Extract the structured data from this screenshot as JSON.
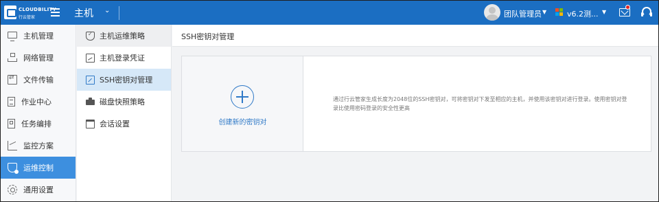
{
  "header": {
    "brand": "CLOUDBILITY",
    "brand_sub": "行云管家",
    "module_title": "主机",
    "user_name": "团队管理员",
    "region_name": "v6.2测..."
  },
  "sidebar": {
    "items": [
      {
        "label": "主机管理",
        "icon": "monitor-icon"
      },
      {
        "label": "网络管理",
        "icon": "network-icon"
      },
      {
        "label": "文件传输",
        "icon": "file-transfer-icon"
      },
      {
        "label": "作业中心",
        "icon": "task-icon"
      },
      {
        "label": "任务编排",
        "icon": "schedule-icon"
      },
      {
        "label": "监控方案",
        "icon": "chart-icon"
      },
      {
        "label": "运维控制",
        "icon": "shield-icon",
        "active": true
      },
      {
        "label": "通用设置",
        "icon": "gear-icon"
      }
    ]
  },
  "submenu": {
    "items": [
      {
        "label": "主机运维策略",
        "icon": "shield-check-icon"
      },
      {
        "label": "主机登录凭证",
        "icon": "login-credential-icon"
      },
      {
        "label": "SSH密钥对管理",
        "icon": "key-icon",
        "active": true
      },
      {
        "label": "磁盘快照策略",
        "icon": "disk-icon"
      },
      {
        "label": "会话设置",
        "icon": "window-icon"
      }
    ]
  },
  "main": {
    "title": "SSH密钥对管理",
    "create_label": "创建新的密钥对",
    "description": "通过行云管家生成长度为2048位的SSH密钥对，可将密钥对下发至相应的主机，并使用该密钥对进行登录。使用密钥对登录比使用密码登录的安全性更高"
  },
  "colors": {
    "topbar": "#1b6ec2",
    "accent": "#2f79c7",
    "sidebar_active": "#3d8fdf",
    "submenu_active": "#d6e8f8"
  }
}
